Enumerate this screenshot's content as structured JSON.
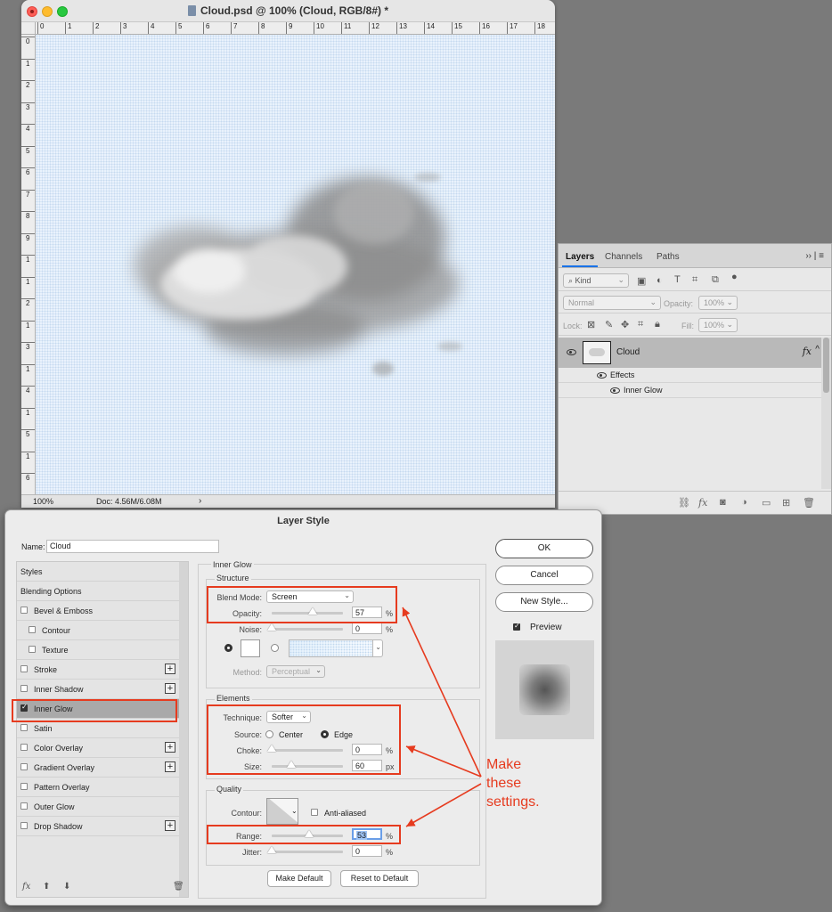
{
  "document": {
    "title": "Cloud.psd @ 100% (Cloud, RGB/8#) *",
    "ruler_top": [
      "0",
      "1",
      "2",
      "3",
      "4",
      "5",
      "6",
      "7",
      "8",
      "9",
      "10",
      "11",
      "12",
      "13",
      "14",
      "15",
      "16",
      "17",
      "18"
    ],
    "ruler_left": [
      "0",
      "1",
      "2",
      "3",
      "4",
      "5",
      "6",
      "7",
      "8",
      "9",
      "1",
      "1",
      "2",
      "1",
      "3",
      "1",
      "4",
      "1",
      "5",
      "1",
      "6"
    ],
    "status": {
      "zoom": "100%",
      "doc": "Doc: 4.56M/6.08M",
      "arrow": "›"
    }
  },
  "layers_panel": {
    "tabs": [
      "Layers",
      "Channels",
      "Paths"
    ],
    "menu": "›› | ≡",
    "filter": {
      "kind": "Kind"
    },
    "blend": {
      "mode": "Normal",
      "opacity_label": "Opacity:",
      "opacity": "100%"
    },
    "lock": {
      "label": "Lock:",
      "fill_label": "Fill:",
      "fill": "100%"
    },
    "layer": {
      "name": "Cloud",
      "fx": "fx",
      "caret": "^"
    },
    "effects_label": "Effects",
    "inner_glow_label": "Inner Glow",
    "footer_icons": [
      "link-icon",
      "fx-icon",
      "mask-icon",
      "adjustment-icon",
      "folder-icon",
      "new-layer-icon",
      "trash-icon"
    ]
  },
  "dialog": {
    "title": "Layer Style",
    "name_label": "Name:",
    "name_value": "Cloud",
    "styles": {
      "header": "Styles",
      "blending": "Blending Options",
      "items": [
        "Bevel & Emboss",
        "Contour",
        "Texture",
        "Stroke",
        "Inner Shadow",
        "Inner Glow",
        "Satin",
        "Color Overlay",
        "Gradient Overlay",
        "Pattern Overlay",
        "Outer Glow",
        "Drop Shadow"
      ],
      "footer": {
        "fx": "fx",
        "up": "⬆",
        "down": "⬇",
        "trash": "🗑"
      }
    },
    "inner_glow": {
      "title": "Inner Glow",
      "structure": {
        "title": "Structure",
        "blend_mode_label": "Blend Mode:",
        "blend_mode": "Screen",
        "opacity_label": "Opacity:",
        "opacity": "57",
        "opacity_fraction": 0.57,
        "noise_label": "Noise:",
        "noise": "0",
        "method_label": "Method:",
        "method": "Perceptual"
      },
      "elements": {
        "title": "Elements",
        "technique_label": "Technique:",
        "technique": "Softer",
        "source_label": "Source:",
        "center": "Center",
        "edge": "Edge",
        "choke_label": "Choke:",
        "choke": "0",
        "size_label": "Size:",
        "size": "60"
      },
      "quality": {
        "title": "Quality",
        "contour_label": "Contour:",
        "anti_aliased": "Anti-aliased",
        "range_label": "Range:",
        "range": "53",
        "jitter_label": "Jitter:",
        "jitter": "0"
      },
      "make_default": "Make Default",
      "reset_default": "Reset to Default"
    },
    "units": {
      "percent": "%",
      "px": "px"
    },
    "buttons": {
      "ok": "OK",
      "cancel": "Cancel",
      "new_style": "New Style...",
      "preview": "Preview"
    }
  },
  "annotation": {
    "lines": [
      "Make",
      "these",
      "settings."
    ],
    "color": "#e63b1f"
  }
}
